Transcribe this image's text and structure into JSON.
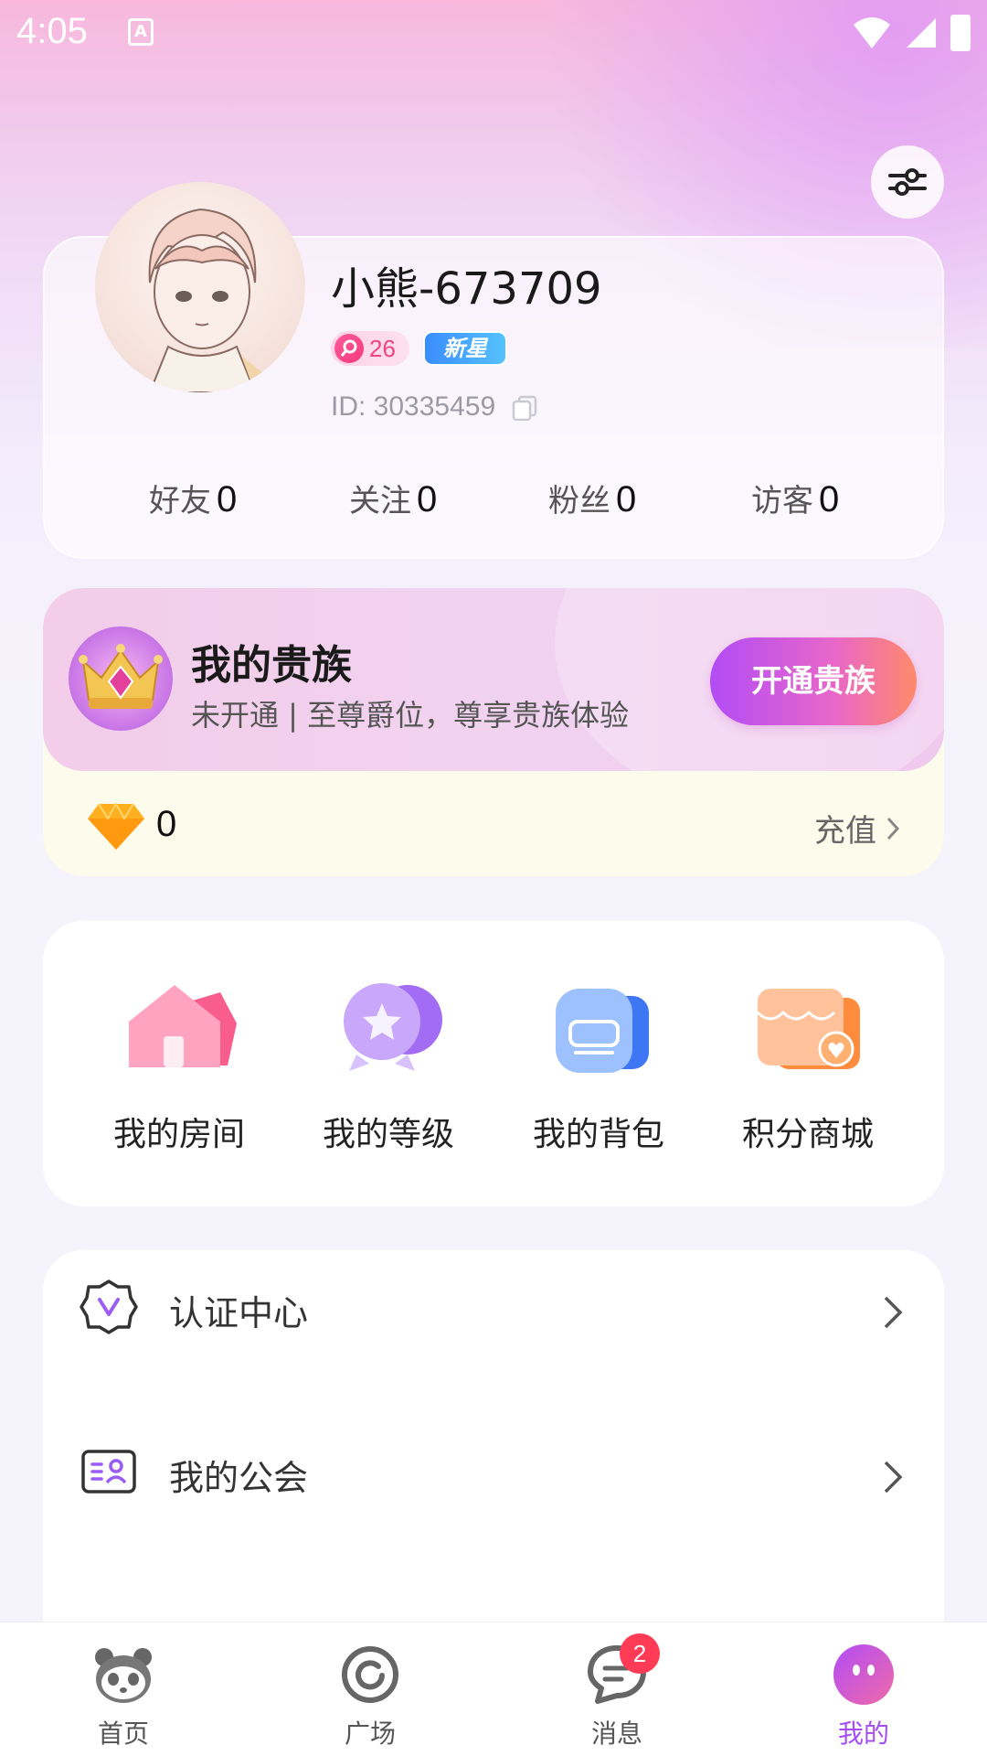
{
  "status_bar": {
    "time": "4:05",
    "notif_icon": "A"
  },
  "profile": {
    "username": "小熊-673709",
    "level": "26",
    "badge": "新星",
    "id_text": "ID: 30335459"
  },
  "stats": [
    {
      "label": "好友",
      "value": "0"
    },
    {
      "label": "关注",
      "value": "0"
    },
    {
      "label": "粉丝",
      "value": "0"
    },
    {
      "label": "访客",
      "value": "0"
    }
  ],
  "noble": {
    "title": "我的贵族",
    "subtitle": "未开通 | 至尊爵位，尊享贵族体验",
    "button": "开通贵族",
    "diamonds": "0",
    "recharge": "充值"
  },
  "features": [
    {
      "label": "我的房间",
      "icon": "room-icon"
    },
    {
      "label": "我的等级",
      "icon": "level-icon"
    },
    {
      "label": "我的背包",
      "icon": "backpack-icon"
    },
    {
      "label": "积分商城",
      "icon": "shop-icon"
    }
  ],
  "menu": [
    {
      "label": "认证中心",
      "icon": "verify-icon"
    },
    {
      "label": "我的公会",
      "icon": "guild-icon"
    }
  ],
  "tabs": [
    {
      "label": "首页",
      "icon": "panda-home-icon"
    },
    {
      "label": "广场",
      "icon": "square-icon"
    },
    {
      "label": "消息",
      "icon": "message-icon",
      "badge": "2"
    },
    {
      "label": "我的",
      "icon": "mine-icon",
      "active": true
    }
  ],
  "colors": {
    "accent": "#a54cf2",
    "badge_red": "#ff3b56"
  }
}
